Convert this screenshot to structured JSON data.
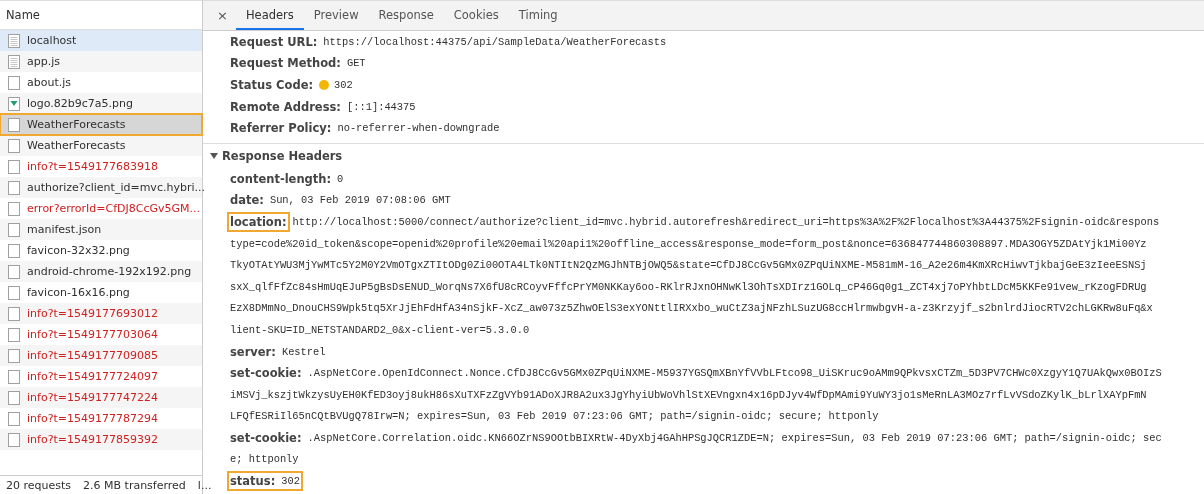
{
  "requests": {
    "column": "Name",
    "rows": [
      {
        "name": "localhost",
        "kind": "doc",
        "hovered": true,
        "selected": false,
        "error": false,
        "highlighted": false
      },
      {
        "name": "app.js",
        "kind": "doc",
        "hovered": false,
        "selected": false,
        "error": false,
        "highlighted": false
      },
      {
        "name": "about.js",
        "kind": "blank",
        "hovered": false,
        "selected": false,
        "error": false,
        "highlighted": false
      },
      {
        "name": "logo.82b9c7a5.png",
        "kind": "image",
        "hovered": false,
        "selected": false,
        "error": false,
        "highlighted": false
      },
      {
        "name": "WeatherForecasts",
        "kind": "blank",
        "hovered": false,
        "selected": true,
        "error": false,
        "highlighted": true
      },
      {
        "name": "WeatherForecasts",
        "kind": "blank",
        "hovered": false,
        "selected": false,
        "error": false,
        "highlighted": false
      },
      {
        "name": "info?t=1549177683918",
        "kind": "blank",
        "hovered": false,
        "selected": false,
        "error": true,
        "highlighted": false
      },
      {
        "name": "authorize?client_id=mvc.hybri...",
        "kind": "blank",
        "hovered": false,
        "selected": false,
        "error": false,
        "highlighted": false
      },
      {
        "name": "error?errorId=CfDJ8CcGv5GM...",
        "kind": "blank",
        "hovered": false,
        "selected": false,
        "error": true,
        "highlighted": false
      },
      {
        "name": "manifest.json",
        "kind": "blank",
        "hovered": false,
        "selected": false,
        "error": false,
        "highlighted": false
      },
      {
        "name": "favicon-32x32.png",
        "kind": "blank",
        "hovered": false,
        "selected": false,
        "error": false,
        "highlighted": false
      },
      {
        "name": "android-chrome-192x192.png",
        "kind": "blank",
        "hovered": false,
        "selected": false,
        "error": false,
        "highlighted": false
      },
      {
        "name": "favicon-16x16.png",
        "kind": "blank",
        "hovered": false,
        "selected": false,
        "error": false,
        "highlighted": false
      },
      {
        "name": "info?t=1549177693012",
        "kind": "blank",
        "hovered": false,
        "selected": false,
        "error": true,
        "highlighted": false
      },
      {
        "name": "info?t=1549177703064",
        "kind": "blank",
        "hovered": false,
        "selected": false,
        "error": true,
        "highlighted": false
      },
      {
        "name": "info?t=1549177709085",
        "kind": "blank",
        "hovered": false,
        "selected": false,
        "error": true,
        "highlighted": false
      },
      {
        "name": "info?t=1549177724097",
        "kind": "blank",
        "hovered": false,
        "selected": false,
        "error": true,
        "highlighted": false
      },
      {
        "name": "info?t=1549177747224",
        "kind": "blank",
        "hovered": false,
        "selected": false,
        "error": true,
        "highlighted": false
      },
      {
        "name": "info?t=1549177787294",
        "kind": "blank",
        "hovered": false,
        "selected": false,
        "error": true,
        "highlighted": false
      },
      {
        "name": "info?t=1549177859392",
        "kind": "blank",
        "hovered": false,
        "selected": false,
        "error": true,
        "highlighted": false
      }
    ],
    "status_bar": [
      "20 requests",
      "2.6 MB transferred",
      "l..."
    ]
  },
  "details": {
    "close": "×",
    "tabs": [
      {
        "label": "Headers",
        "selected": true
      },
      {
        "label": "Preview",
        "selected": false
      },
      {
        "label": "Response",
        "selected": false
      },
      {
        "label": "Cookies",
        "selected": false
      },
      {
        "label": "Timing",
        "selected": false
      }
    ],
    "general": [
      {
        "name": "Request URL:",
        "value": "https://localhost:44375/api/SampleData/WeatherForecasts"
      },
      {
        "name": "Request Method:",
        "value": "GET"
      },
      {
        "name": "Status Code:",
        "value": "302",
        "color": "#f2b705"
      },
      {
        "name": "Remote Address:",
        "value": "[::1]:44375"
      },
      {
        "name": "Referrer Policy:",
        "value": "no-referrer-when-downgrade"
      }
    ],
    "response_headers": {
      "title": "Response Headers",
      "expanded": true,
      "headers": [
        {
          "name": "content-length:",
          "lines": [
            "0"
          ],
          "highlighted": false
        },
        {
          "name": "date:",
          "lines": [
            "Sun, 03 Feb 2019 07:08:06 GMT"
          ],
          "highlighted": false
        },
        {
          "name": "location:",
          "highlighted": true,
          "lines": [
            "http://localhost:5000/connect/authorize?client_id=mvc.hybrid.autorefresh&redirect_uri=https%3A%2F%2Flocalhost%3A44375%2Fsignin-oidc&respons",
            "type=code%20id_token&scope=openid%20profile%20email%20api1%20offline_access&response_mode=form_post&nonce=636847744860308897.MDA3OGY5ZDAtYjk1Mi00Yz",
            "TkyOTAtYWU3MjYwMTc5Y2M0Y2VmOTgxZTItODg0Zi00OTA4LTk0NTItN2QzMGJhNTBjOWQ5&state=CfDJ8CcGv5GMx0ZPqUiNXME-M581mM-16_A2e26m4KmXRcHiwvTjkbajGeE3zIeeESNSj",
            "sxX_qlfFfZc84sHmUqEJuP5gBsDsENUD_WorqNs7X6fU8cRCoyvFffcPrYM0NKKay6oo-RKlrRJxnOHNwKl3OhTsXDIrz1GOLq_cP46Gq0g1_ZCT4xj7oPYhbtLDcM5KKFe91vew_rKzogFDRUg",
            "EzX8DMmNo_DnouCHS9Wpk5tq5XrJjEhFdHfA34nSjkF-XcZ_aw073z5ZhwOElS3exYONttlIRXxbo_wuCtZ3ajNFzhLSuzUG8ccHlrmwbgvH-a-z3Krzyjf_s2bnlrdJiocRTV2chLGKRw8uFq&x",
            "lient-SKU=ID_NETSTANDARD2_0&x-client-ver=5.3.0.0"
          ]
        },
        {
          "name": "server:",
          "lines": [
            "Kestrel"
          ],
          "highlighted": false
        },
        {
          "name": "set-cookie:",
          "highlighted": false,
          "lines": [
            ".AspNetCore.OpenIdConnect.Nonce.CfDJ8CcGv5GMx0ZPqUiNXME-M5937YGSQmXBnYfVVbLFtco98_UiSKruc9oAMm9QPkvsxCTZm_5D3PV7CHWc0XzgyY1Q7UAkQwx0BOIzS",
            "iMSVj_kszjtWkzysUyEH0KfED3oyj8ukH86sXuTXFzZgVYb91ADoXJR8A2ux3JgYhyiUbWoVhlStXEVngxn4x16pDJyv4WfDpMAmi9YuWY3jo1sMeRnLA3MOz7rfLvVSdoZKylK_bLrlXAYpFmN",
            "LFQfESRiIl65nCQtBVUgQ78Irw=N; expires=Sun, 03 Feb 2019 07:23:06 GMT; path=/signin-oidc; secure; httponly"
          ]
        },
        {
          "name": "set-cookie:",
          "highlighted": false,
          "lines": [
            ".AspNetCore.Correlation.oidc.KN66OZrNS9OOtbBIXRtW-4DyXbj4GAhHPSgJQCR1ZDE=N; expires=Sun, 03 Feb 2019 07:23:06 GMT; path=/signin-oidc; sec",
            "e; httponly"
          ]
        },
        {
          "name": "status:",
          "lines": [
            "302"
          ],
          "highlighted": true
        }
      ]
    }
  }
}
